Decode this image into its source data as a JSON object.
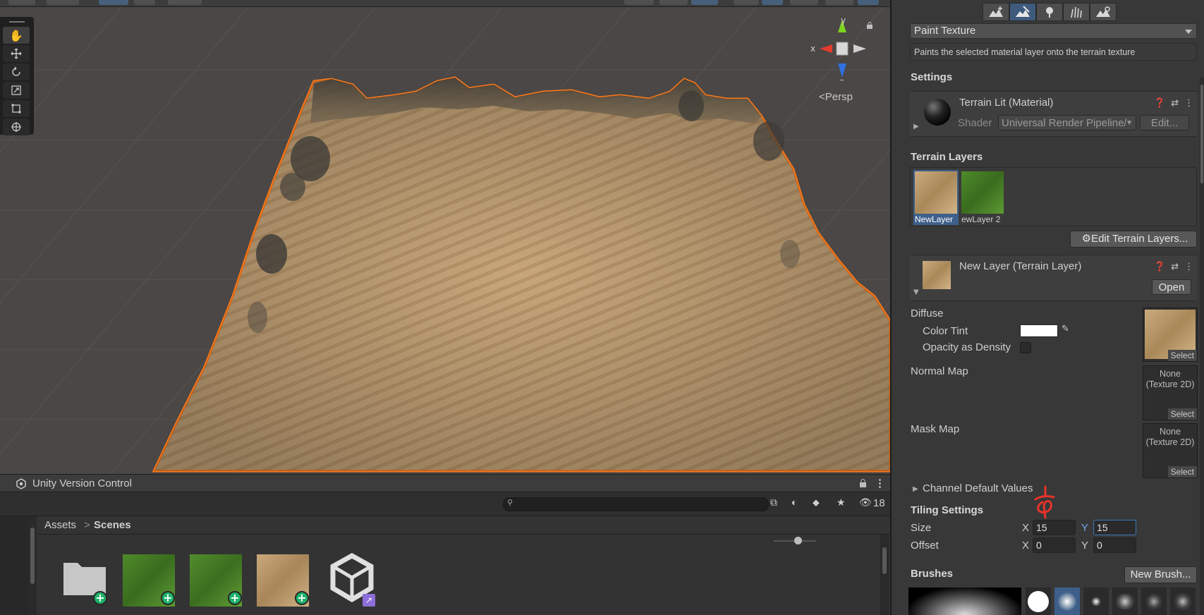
{
  "scene": {
    "persp_label": "Persp",
    "gizmo": {
      "x": "x",
      "y": "y",
      "z": "z"
    }
  },
  "inspector": {
    "tool_dropdown": "Paint Texture",
    "help_text": "Paints the selected material layer onto the terrain texture",
    "settings_title": "Settings",
    "material": {
      "name": "Terrain Lit (Material)",
      "shader_label": "Shader",
      "shader_value": "Universal Render Pipeline/",
      "edit_label": "Edit..."
    },
    "terrain_layers_title": "Terrain Layers",
    "layers": [
      {
        "label": "NewLayer",
        "selected": true
      },
      {
        "label": "ewLayer 2",
        "selected": false
      }
    ],
    "edit_layers_button": "Edit Terrain Layers...",
    "layer_card": {
      "name": "New Layer (Terrain Layer)",
      "open_label": "Open"
    },
    "diffuse_label": "Diffuse",
    "color_tint_label": "Color Tint",
    "opacity_label": "Opacity as Density",
    "normal_map_label": "Normal Map",
    "mask_map_label": "Mask Map",
    "none_texture": "None\n(Texture 2D)",
    "select_label": "Select",
    "channel_defaults_label": "Channel Default Values",
    "tiling_title": "Tiling Settings",
    "size_label": "Size",
    "offset_label": "Offset",
    "axis_x": "X",
    "axis_y": "Y",
    "size_x": "15",
    "size_y": "15",
    "offset_x": "0",
    "offset_y": "0",
    "brushes_title": "Brushes",
    "new_brush_button": "New Brush..."
  },
  "project": {
    "vc_title": "Unity Version Control",
    "visible_count": "18",
    "breadcrumb": [
      "Assets",
      "Scenes"
    ],
    "breadcrumb_sep": ">"
  },
  "colors": {
    "selection_outline": "#ff7a1a",
    "accent_blue": "#3a79bb",
    "add_badge": "#1fb36b",
    "annotation_red": "#e8332a"
  }
}
